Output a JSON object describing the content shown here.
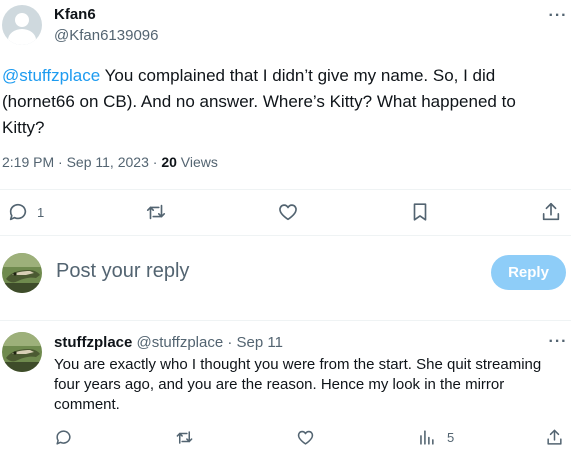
{
  "tweet": {
    "author_name": "Kfan6",
    "author_handle": "@Kfan6139096",
    "mention": "@stuffzplace",
    "text": " You complained that I didn’t give my name. So, I did (hornet66 on CB). And no answer. Where’s Kitty? What happened to Kitty?",
    "time": "2:19 PM",
    "date": "Sep 11, 2023",
    "views_count": "20",
    "views_label": "Views",
    "reply_count": "1",
    "more_label": "···"
  },
  "composer": {
    "placeholder": "Post your reply",
    "button_label": "Reply"
  },
  "reply": {
    "author_name": "stuffzplace",
    "author_handle": "@stuffzplace",
    "separator": "·",
    "date": "Sep 11",
    "text": "You are exactly who I thought you were from the start. She quit streaming four years ago, and you are the reason. Hence my look in the mirror comment.",
    "views_count": "5",
    "more_label": "···"
  },
  "icons": {
    "reply": "reply-icon",
    "retweet": "retweet-icon",
    "like": "heart-icon",
    "bookmark": "bookmark-icon",
    "share": "share-icon",
    "views": "analytics-icon",
    "more": "more-icon",
    "avatar_default": "default-avatar",
    "avatar_gator": "alligator-avatar"
  },
  "colors": {
    "accent": "#1d9bf0",
    "button_disabled": "#8ecdf8",
    "secondary_text": "#536471",
    "primary_text": "#0f1419"
  }
}
